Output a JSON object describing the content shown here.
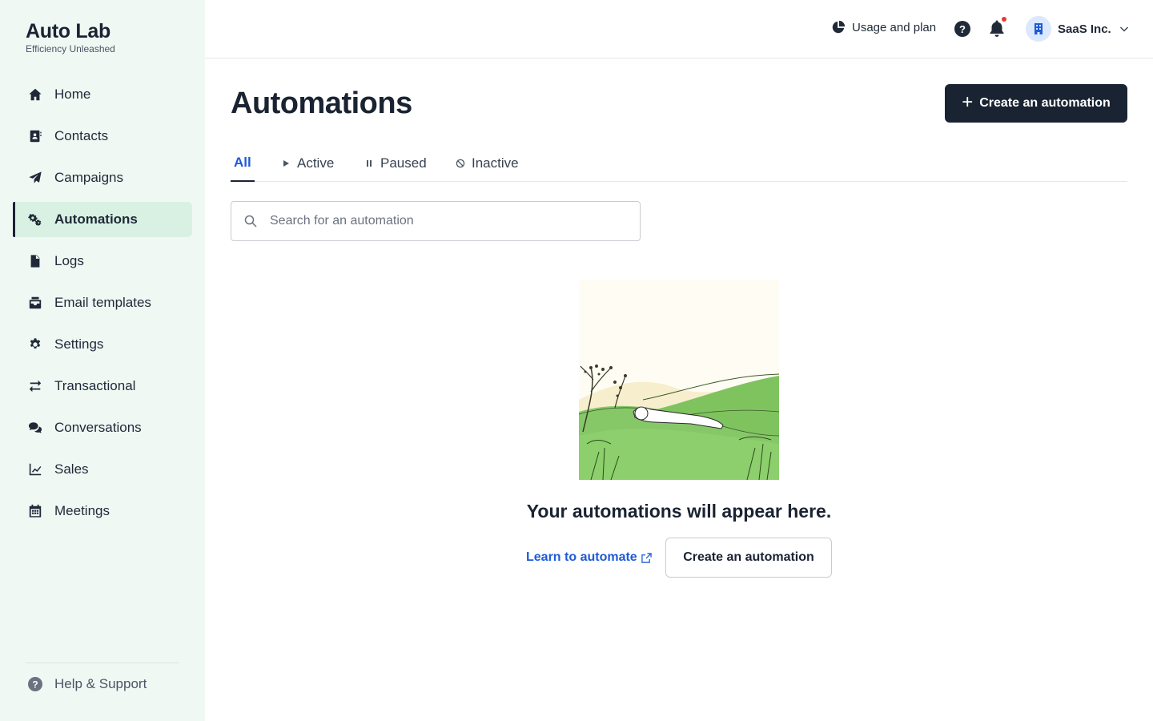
{
  "brand": {
    "title": "Auto Lab",
    "subtitle": "Efficiency Unleashed"
  },
  "sidebar": {
    "items": [
      {
        "label": "Home",
        "icon": "home-icon"
      },
      {
        "label": "Contacts",
        "icon": "contacts-icon"
      },
      {
        "label": "Campaigns",
        "icon": "paper-plane-icon"
      },
      {
        "label": "Automations",
        "icon": "gears-icon",
        "active": true
      },
      {
        "label": "Logs",
        "icon": "document-icon"
      },
      {
        "label": "Email templates",
        "icon": "inbox-icon"
      },
      {
        "label": "Settings",
        "icon": "gear-icon"
      },
      {
        "label": "Transactional",
        "icon": "arrows-exchange-icon"
      },
      {
        "label": "Conversations",
        "icon": "chat-bubbles-icon"
      },
      {
        "label": "Sales",
        "icon": "line-chart-icon"
      },
      {
        "label": "Meetings",
        "icon": "calendar-icon"
      }
    ],
    "help_label": "Help & Support"
  },
  "header": {
    "usage_label": "Usage and plan",
    "org_name": "SaaS Inc."
  },
  "main": {
    "title": "Automations",
    "create_label": "Create an automation",
    "tabs": [
      {
        "label": "All",
        "active": true
      },
      {
        "label": "Active",
        "icon": "play-icon"
      },
      {
        "label": "Paused",
        "icon": "pause-icon"
      },
      {
        "label": "Inactive",
        "icon": "ban-icon"
      }
    ],
    "search_placeholder": "Search for an automation",
    "empty": {
      "title": "Your automations will appear here.",
      "learn_label": "Learn to automate",
      "create_label": "Create an automation"
    }
  },
  "colors": {
    "sidebar_bg": "#f0f8f4",
    "active_item_bg": "#d9f1e3",
    "primary_dark": "#1a2332",
    "link_blue": "#1e5bd8",
    "notification_dot": "#e53935"
  }
}
